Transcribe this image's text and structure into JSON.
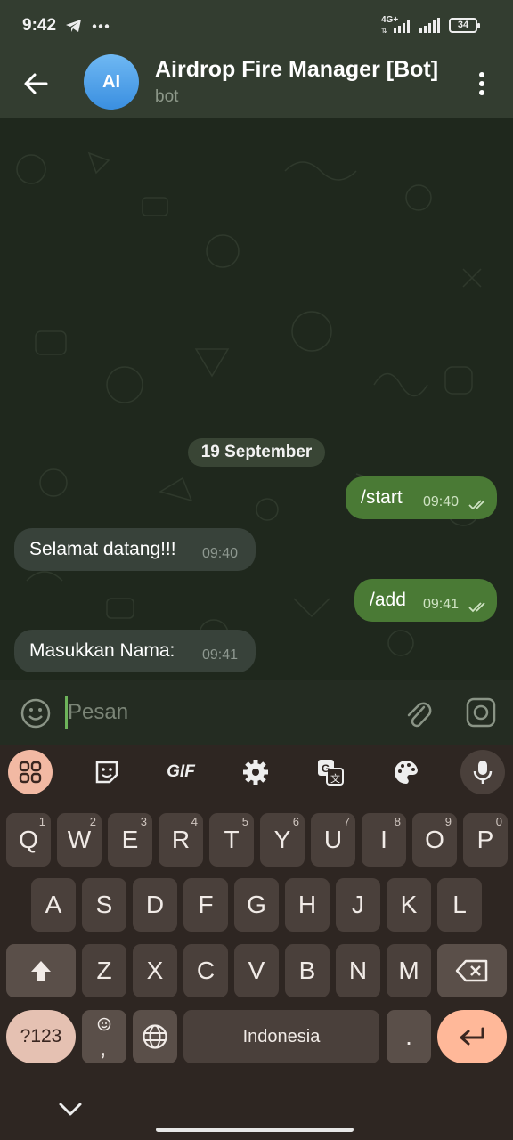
{
  "status": {
    "time": "9:42",
    "network": "4G+",
    "battery": "34"
  },
  "header": {
    "avatar": "AI",
    "title": "Airdrop Fire Manager [Bot]",
    "subtitle": "bot"
  },
  "chat": {
    "date": "19 September",
    "messages": [
      {
        "dir": "out",
        "text": "/start",
        "time": "09:40"
      },
      {
        "dir": "in",
        "text": "Selamat datang!!!",
        "time": "09:40"
      },
      {
        "dir": "out",
        "text": "/add",
        "time": "09:41"
      },
      {
        "dir": "in",
        "text": "Masukkan Nama:",
        "time": "09:41"
      }
    ]
  },
  "input": {
    "placeholder": "Pesan"
  },
  "keyboard": {
    "toolbar": [
      "apps-icon",
      "sticker-icon",
      "gif",
      "settings-icon",
      "translate-icon",
      "palette-icon",
      "mic-icon"
    ],
    "gif_label": "GIF",
    "row1": [
      {
        "k": "Q",
        "n": "1"
      },
      {
        "k": "W",
        "n": "2"
      },
      {
        "k": "E",
        "n": "3"
      },
      {
        "k": "R",
        "n": "4"
      },
      {
        "k": "T",
        "n": "5"
      },
      {
        "k": "Y",
        "n": "6"
      },
      {
        "k": "U",
        "n": "7"
      },
      {
        "k": "I",
        "n": "8"
      },
      {
        "k": "O",
        "n": "9"
      },
      {
        "k": "P",
        "n": "0"
      }
    ],
    "row2": [
      "A",
      "S",
      "D",
      "F",
      "G",
      "H",
      "J",
      "K",
      "L"
    ],
    "row3": [
      "Z",
      "X",
      "C",
      "V",
      "B",
      "N",
      "M"
    ],
    "sym_label": "?123",
    "comma": ",",
    "space_label": "Indonesia",
    "period": "."
  },
  "colors": {
    "outgoing": "#4a7a35",
    "incoming": "#38423a",
    "accent": "#6db35a",
    "enter": "#ffb899"
  }
}
